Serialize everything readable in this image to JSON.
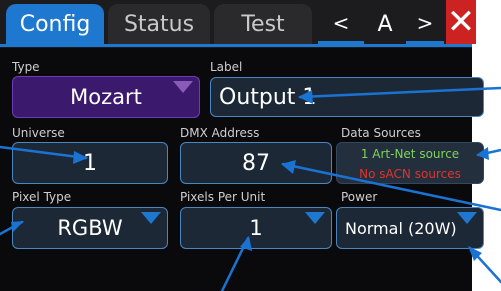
{
  "tabs": [
    {
      "label": "Config",
      "active": true
    },
    {
      "label": "Status",
      "active": false
    },
    {
      "label": "Test",
      "active": false
    }
  ],
  "nav": {
    "prev": "<",
    "current": "A",
    "next": ">"
  },
  "close": {
    "symbol": "✕",
    "icon": "close-icon"
  },
  "fields": {
    "type": {
      "label": "Type",
      "value": "Mozart"
    },
    "name": {
      "label": "Label",
      "value": "Output 1"
    },
    "universe": {
      "label": "Universe",
      "value": "1"
    },
    "dmx_address": {
      "label": "DMX Address",
      "value": "87"
    },
    "data_sources": {
      "label": "Data Sources",
      "lines": [
        "1 Art-Net source",
        "No sACN sources"
      ]
    },
    "pixel_type": {
      "label": "Pixel Type",
      "value": "RGBW"
    },
    "pixels_per_unit": {
      "label": "Pixels Per Unit",
      "value": "1"
    },
    "power": {
      "label": "Power",
      "value": "Normal (20W)"
    }
  },
  "colors": {
    "accent": "#1f78cf",
    "type_bg": "#3b1a6e",
    "close_bg": "#cc2222",
    "source_ok": "#7ed35a",
    "source_none": "#e0332d"
  }
}
